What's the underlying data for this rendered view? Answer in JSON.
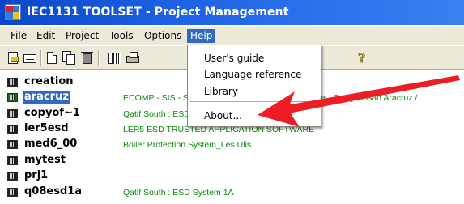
{
  "window": {
    "title": "IEC1131 TOOLSET - Project Management"
  },
  "menubar": {
    "items": [
      {
        "label": "File"
      },
      {
        "label": "Edit"
      },
      {
        "label": "Project"
      },
      {
        "label": "Tools"
      },
      {
        "label": "Options"
      },
      {
        "label": "Help",
        "active": true
      }
    ]
  },
  "help_menu": {
    "items": [
      {
        "label": "User's guide"
      },
      {
        "label": "Language reference"
      },
      {
        "label": "Library"
      },
      {
        "label": "About..."
      }
    ]
  },
  "projects": [
    {
      "name": "creation",
      "description": ""
    },
    {
      "name": "aracruz",
      "description": "ECOMP - SIS - Sistema Instrumentado de Segurança - Compressão Aracruz /",
      "selected": true
    },
    {
      "name": "copyof~1",
      "description": "Qatif South : ESD System 1A"
    },
    {
      "name": "ler5esd",
      "description": "LER5 ESD TRUSTED APPLICATION SOFTWARE"
    },
    {
      "name": "med6_00",
      "description": "Boiler Protection System_Les Ulis"
    },
    {
      "name": "mytest",
      "description": ""
    },
    {
      "name": "prj1",
      "description": ""
    },
    {
      "name": "q08esd1a",
      "description": "Qatif South : ESD System 1A"
    }
  ],
  "annotation": {
    "arrow_color": "#ee1c24"
  },
  "colors": {
    "titlebar": "#0a46c8",
    "selection": "#316ac5",
    "description_text": "#0a8a0a"
  }
}
